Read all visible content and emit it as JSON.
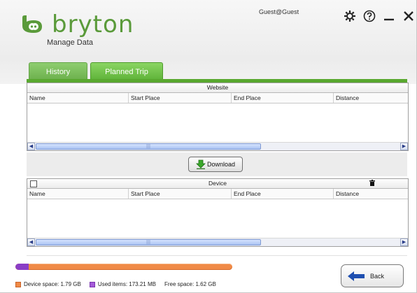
{
  "app": {
    "brand": "bryton",
    "subtitle": "Manage Data",
    "user": "Guest@Guest"
  },
  "window_controls": [
    {
      "name": "settings-icon",
      "glyph": "⚙"
    },
    {
      "name": "help-icon",
      "glyph": "?"
    },
    {
      "name": "minimize-icon",
      "glyph": "—"
    },
    {
      "name": "close-icon",
      "glyph": "✕"
    }
  ],
  "tabs": [
    {
      "label": "History",
      "active": false
    },
    {
      "label": "Planned Trip",
      "active": true
    }
  ],
  "website": {
    "section_label": "Website",
    "columns": [
      "Name",
      "Start Place",
      "End Place",
      "Distance"
    ]
  },
  "download_label": "Download",
  "device": {
    "section_label": "Device",
    "columns": [
      "Name",
      "Start Place",
      "End Place",
      "Distance"
    ]
  },
  "storage": {
    "used_fraction": 0.06,
    "device_space": "Device space: 1.79 GB",
    "used_items": "Used items: 173.21 MB",
    "free_space": "Free space: 1.62 GB",
    "colors": {
      "device": "#f08a46",
      "used": "#8a3ec6",
      "accent": "#59a82f"
    }
  },
  "back_label": "Back"
}
